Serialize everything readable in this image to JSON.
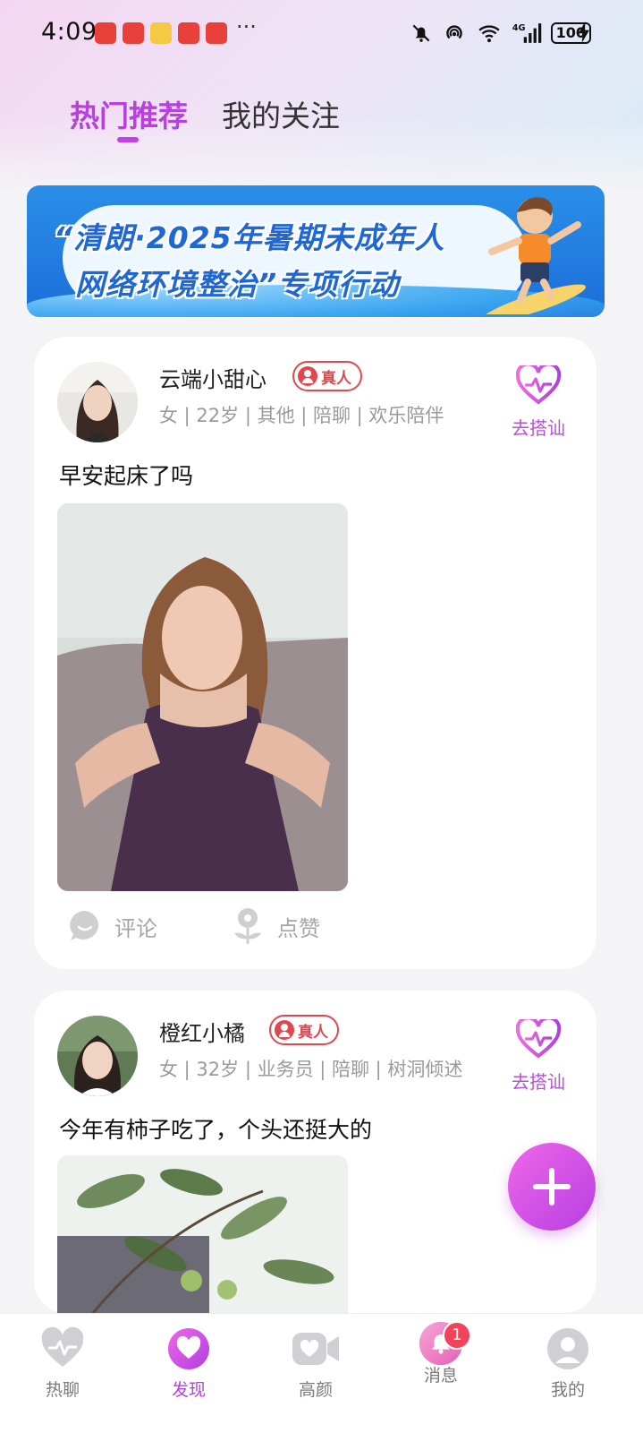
{
  "status_bar": {
    "time": "4:09",
    "more": "···",
    "battery": "100",
    "icons": [
      "mute-icon",
      "hotspot-icon",
      "wifi-icon",
      "4g-signal-icon",
      "battery-icon",
      "charging-icon"
    ]
  },
  "tabs": [
    {
      "label": "热门推荐",
      "active": true
    },
    {
      "label": "我的关注",
      "active": false
    }
  ],
  "banner": {
    "line1": "“清朗·2025年暑期未成年人",
    "line2": "网络环境整治”专项行动"
  },
  "posts": [
    {
      "username": "云端小甜心",
      "badge": "真人",
      "meta": "女 | 22岁 | 其他 | 陪聊 | 欢乐陪伴",
      "greet_label": "去搭讪",
      "text": "早安起床了吗",
      "comment_label": "评论",
      "like_label": "点赞"
    },
    {
      "username": "橙红小橘",
      "badge": "真人",
      "meta": "女 | 32岁 | 业务员 | 陪聊 | 树洞倾述",
      "greet_label": "去搭讪",
      "text": "今年有柿子吃了，个头还挺大的"
    }
  ],
  "bottom_nav": [
    {
      "label": "热聊",
      "icon": "heartbeat-icon",
      "active": false
    },
    {
      "label": "发现",
      "icon": "heart-icon",
      "active": true
    },
    {
      "label": "高颜",
      "icon": "video-icon",
      "active": false
    },
    {
      "label": "消息",
      "icon": "bell-icon",
      "active": false,
      "badge": "1"
    },
    {
      "label": "我的",
      "icon": "user-icon",
      "active": false
    }
  ],
  "colors": {
    "accent": "#b63fe2",
    "real_badge": "#e2474d",
    "notification_badge": "#f3425b"
  }
}
